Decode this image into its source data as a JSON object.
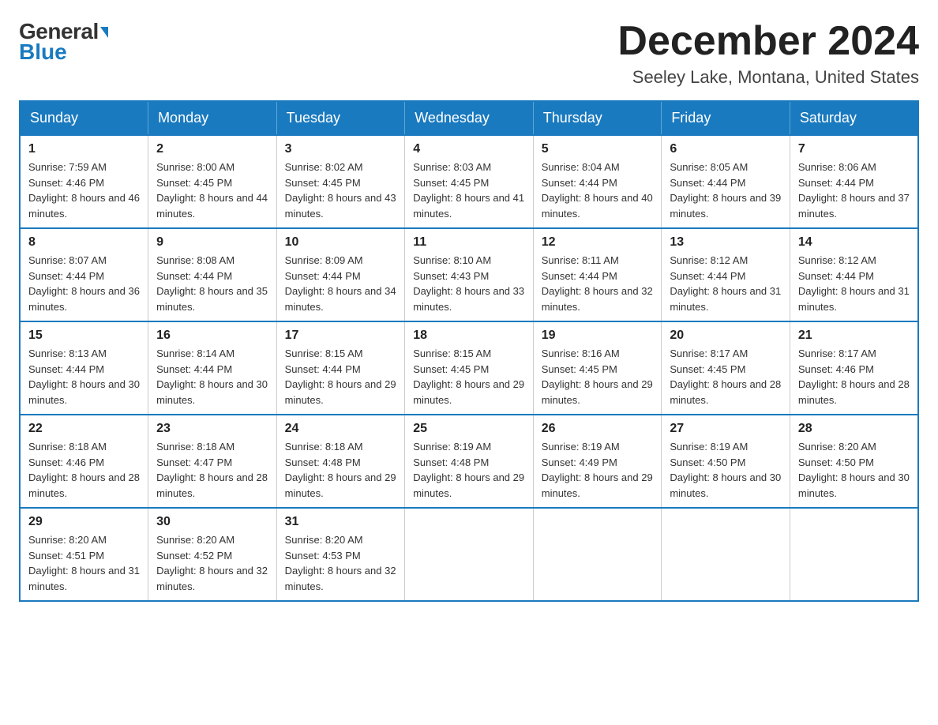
{
  "header": {
    "logo_general": "General",
    "logo_blue": "Blue",
    "month_title": "December 2024",
    "location": "Seeley Lake, Montana, United States"
  },
  "days_of_week": [
    "Sunday",
    "Monday",
    "Tuesday",
    "Wednesday",
    "Thursday",
    "Friday",
    "Saturday"
  ],
  "weeks": [
    [
      {
        "day": "1",
        "sunrise": "7:59 AM",
        "sunset": "4:46 PM",
        "daylight": "8 hours and 46 minutes."
      },
      {
        "day": "2",
        "sunrise": "8:00 AM",
        "sunset": "4:45 PM",
        "daylight": "8 hours and 44 minutes."
      },
      {
        "day": "3",
        "sunrise": "8:02 AM",
        "sunset": "4:45 PM",
        "daylight": "8 hours and 43 minutes."
      },
      {
        "day": "4",
        "sunrise": "8:03 AM",
        "sunset": "4:45 PM",
        "daylight": "8 hours and 41 minutes."
      },
      {
        "day": "5",
        "sunrise": "8:04 AM",
        "sunset": "4:44 PM",
        "daylight": "8 hours and 40 minutes."
      },
      {
        "day": "6",
        "sunrise": "8:05 AM",
        "sunset": "4:44 PM",
        "daylight": "8 hours and 39 minutes."
      },
      {
        "day": "7",
        "sunrise": "8:06 AM",
        "sunset": "4:44 PM",
        "daylight": "8 hours and 37 minutes."
      }
    ],
    [
      {
        "day": "8",
        "sunrise": "8:07 AM",
        "sunset": "4:44 PM",
        "daylight": "8 hours and 36 minutes."
      },
      {
        "day": "9",
        "sunrise": "8:08 AM",
        "sunset": "4:44 PM",
        "daylight": "8 hours and 35 minutes."
      },
      {
        "day": "10",
        "sunrise": "8:09 AM",
        "sunset": "4:44 PM",
        "daylight": "8 hours and 34 minutes."
      },
      {
        "day": "11",
        "sunrise": "8:10 AM",
        "sunset": "4:43 PM",
        "daylight": "8 hours and 33 minutes."
      },
      {
        "day": "12",
        "sunrise": "8:11 AM",
        "sunset": "4:44 PM",
        "daylight": "8 hours and 32 minutes."
      },
      {
        "day": "13",
        "sunrise": "8:12 AM",
        "sunset": "4:44 PM",
        "daylight": "8 hours and 31 minutes."
      },
      {
        "day": "14",
        "sunrise": "8:12 AM",
        "sunset": "4:44 PM",
        "daylight": "8 hours and 31 minutes."
      }
    ],
    [
      {
        "day": "15",
        "sunrise": "8:13 AM",
        "sunset": "4:44 PM",
        "daylight": "8 hours and 30 minutes."
      },
      {
        "day": "16",
        "sunrise": "8:14 AM",
        "sunset": "4:44 PM",
        "daylight": "8 hours and 30 minutes."
      },
      {
        "day": "17",
        "sunrise": "8:15 AM",
        "sunset": "4:44 PM",
        "daylight": "8 hours and 29 minutes."
      },
      {
        "day": "18",
        "sunrise": "8:15 AM",
        "sunset": "4:45 PM",
        "daylight": "8 hours and 29 minutes."
      },
      {
        "day": "19",
        "sunrise": "8:16 AM",
        "sunset": "4:45 PM",
        "daylight": "8 hours and 29 minutes."
      },
      {
        "day": "20",
        "sunrise": "8:17 AM",
        "sunset": "4:45 PM",
        "daylight": "8 hours and 28 minutes."
      },
      {
        "day": "21",
        "sunrise": "8:17 AM",
        "sunset": "4:46 PM",
        "daylight": "8 hours and 28 minutes."
      }
    ],
    [
      {
        "day": "22",
        "sunrise": "8:18 AM",
        "sunset": "4:46 PM",
        "daylight": "8 hours and 28 minutes."
      },
      {
        "day": "23",
        "sunrise": "8:18 AM",
        "sunset": "4:47 PM",
        "daylight": "8 hours and 28 minutes."
      },
      {
        "day": "24",
        "sunrise": "8:18 AM",
        "sunset": "4:48 PM",
        "daylight": "8 hours and 29 minutes."
      },
      {
        "day": "25",
        "sunrise": "8:19 AM",
        "sunset": "4:48 PM",
        "daylight": "8 hours and 29 minutes."
      },
      {
        "day": "26",
        "sunrise": "8:19 AM",
        "sunset": "4:49 PM",
        "daylight": "8 hours and 29 minutes."
      },
      {
        "day": "27",
        "sunrise": "8:19 AM",
        "sunset": "4:50 PM",
        "daylight": "8 hours and 30 minutes."
      },
      {
        "day": "28",
        "sunrise": "8:20 AM",
        "sunset": "4:50 PM",
        "daylight": "8 hours and 30 minutes."
      }
    ],
    [
      {
        "day": "29",
        "sunrise": "8:20 AM",
        "sunset": "4:51 PM",
        "daylight": "8 hours and 31 minutes."
      },
      {
        "day": "30",
        "sunrise": "8:20 AM",
        "sunset": "4:52 PM",
        "daylight": "8 hours and 32 minutes."
      },
      {
        "day": "31",
        "sunrise": "8:20 AM",
        "sunset": "4:53 PM",
        "daylight": "8 hours and 32 minutes."
      },
      null,
      null,
      null,
      null
    ]
  ]
}
